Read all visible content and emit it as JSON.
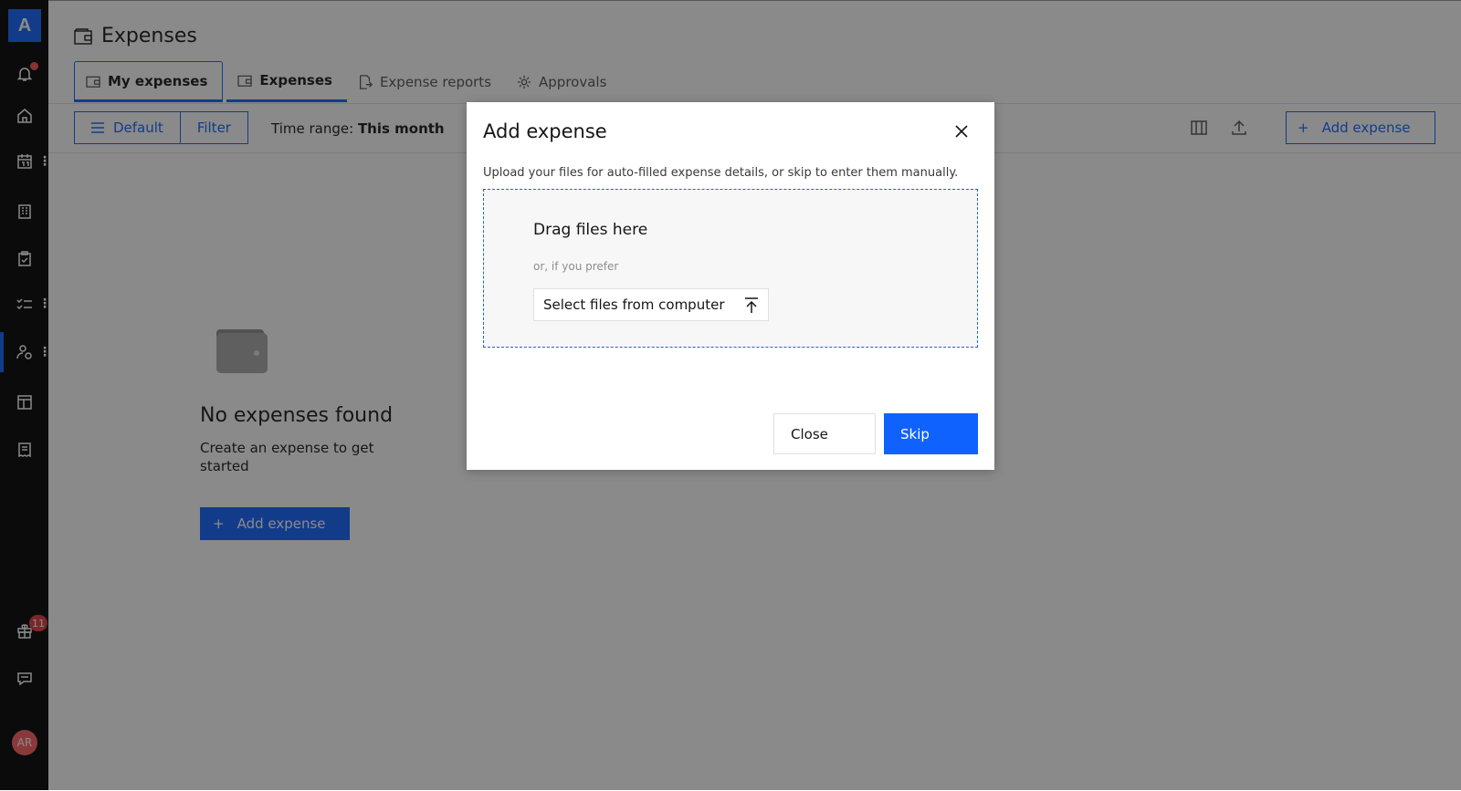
{
  "rail": {
    "logo": "A",
    "items": [
      {
        "name": "notifications-icon",
        "has_dot": true
      },
      {
        "name": "home-icon"
      },
      {
        "name": "calendar-icon",
        "has_menu": true
      },
      {
        "name": "building-icon"
      },
      {
        "name": "clipboard-check-icon"
      },
      {
        "name": "task-list-icon",
        "has_menu": true
      },
      {
        "name": "people-settings-icon",
        "has_menu": true,
        "active": true
      },
      {
        "name": "layout-icon"
      },
      {
        "name": "receipt-icon"
      }
    ],
    "gift_badge": "11",
    "avatar_initials": "AR",
    "menu_glyph": "⋮"
  },
  "header": {
    "title": "Expenses",
    "tabs": [
      {
        "label": "My expenses",
        "icon": "wallet-icon",
        "state": "selected"
      },
      {
        "label": "Expenses",
        "icon": "wallet-icon",
        "state": "bold"
      },
      {
        "label": "Expense reports",
        "icon": "document-export-icon",
        "state": "normal"
      },
      {
        "label": "Approvals",
        "icon": "gear-icon",
        "state": "normal"
      }
    ]
  },
  "toolbar": {
    "view_label": "Default",
    "filter_label": "Filter",
    "time_range_label": "Time range:",
    "time_range_value": "This month",
    "add_expense_label": "Add expense",
    "plus_glyph": "+"
  },
  "empty_state": {
    "title": "No expenses found",
    "subtitle": "Create an expense to get started",
    "button_label": "Add expense"
  },
  "modal": {
    "title": "Add expense",
    "description": "Upload your files for auto-filled expense details, or skip to enter them manually.",
    "dropzone_title": "Drag files here",
    "dropzone_sub": "or, if you prefer",
    "select_files_label": "Select files from computer",
    "close_label": "Close",
    "skip_label": "Skip"
  },
  "colors": {
    "primary": "#0f62fe",
    "rail_bg": "#000000",
    "badge_red": "#e0383e",
    "avatar": "#ff5c61",
    "overlay": "rgba(22,22,22,0.5)"
  }
}
